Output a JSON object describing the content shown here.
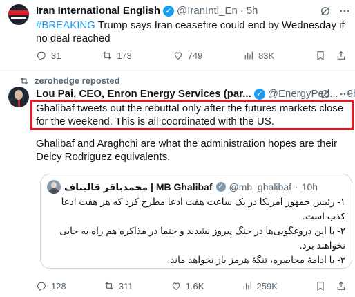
{
  "tweet1": {
    "author_name": "Iran International English",
    "author_handle": "@IranIntl_En",
    "time": "5h",
    "hashtag": "#BREAKING",
    "text": " Trump says Iran ceasefire could end by Wednesday if no deal reached",
    "stats": {
      "replies": "31",
      "reposts": "173",
      "likes": "749",
      "views": "83K"
    }
  },
  "tweet2": {
    "reposted_by": "zerohedge reposted",
    "author_name": "Lou Pai, CEO, Enron Energy Services (par...",
    "author_handle": "@EnergyPed...",
    "time": "9h",
    "text_highlighted": "Ghalibaf tweets out the rebuttal only after the futures markets close for the weekend. This is all coordinated with the US.",
    "text_2": "Ghalibaf and Araghchi are what the administration hopes are their Delcy Rodriguez equivalents.",
    "stats": {
      "replies": "128",
      "reposts": "311",
      "likes": "1.6K",
      "views": "259K"
    },
    "quote": {
      "author_name": "محمدباقر قالیباف | MB Ghalibaf",
      "author_handle": "@mb_ghalibaf",
      "time": "10h",
      "line1": "۱- رئیس جمهور آمریکا در یک ساعت هفت ادعا مطرح کرد که هر هفت ادعا کذب است.",
      "line2": "۲- با این دروغگویی‌ها در جنگ پیروز نشدند و حتما در مذاکره هم راه به جایی نخواهند برد.",
      "line3": "۳- با ادامهٔ محاصره، تنگهٔ هرمز باز نخواهد ماند."
    }
  },
  "colors": {
    "accent": "#1d9bf0",
    "highlight_border": "#e01922",
    "muted": "#536471"
  }
}
